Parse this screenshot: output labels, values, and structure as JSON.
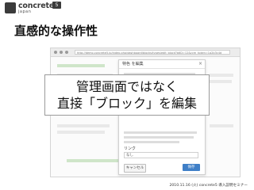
{
  "logo": {
    "name": "concrete",
    "version": "5",
    "sub": "japan"
  },
  "slide": {
    "title": "直感的な操作性"
  },
  "browser": {
    "url": "http://demo.concrete5.jp/index.php/dashboard/blocks/types/edit_block?btID=12&ccm_token=1a2b3c4d"
  },
  "modal": {
    "title": "特色 を編集",
    "close_icon": "close-icon",
    "label": "リンク",
    "select_value": "なし",
    "cancel_label": "キャンセル",
    "save_label": "保存"
  },
  "callout": {
    "line1": "管理画面ではなく",
    "line2": "直接「ブロック」を編集"
  },
  "footer": {
    "text": "2010.11.16 (火) concrete5 導入説明セミナー"
  }
}
